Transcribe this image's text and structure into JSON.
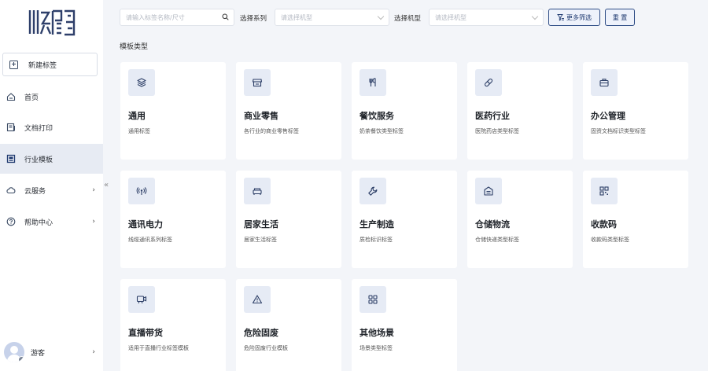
{
  "brand": {
    "logo_text": "斯码"
  },
  "sidebar": {
    "new_label": "新建标签",
    "items": [
      {
        "label": "首页",
        "icon": "home-icon"
      },
      {
        "label": "文档打印",
        "icon": "document-print-icon"
      },
      {
        "label": "行业模板",
        "icon": "template-icon",
        "active": true
      },
      {
        "label": "云服务",
        "icon": "cloud-icon",
        "has_children": true
      },
      {
        "label": "帮助中心",
        "icon": "help-icon",
        "has_children": true
      }
    ],
    "collapse_glyph": "«",
    "user_name": "游客"
  },
  "filters": {
    "search_placeholder": "请输入标签名称/尺寸",
    "series_label": "选择系列",
    "series_placeholder": "请选择机型",
    "model_label": "选择机型",
    "model_placeholder": "请选择机型",
    "more_label": "更多筛选",
    "reset_label": "重 置"
  },
  "section_title": "模板类型",
  "cards": [
    {
      "title": "通用",
      "desc": "通用标签",
      "icon": "layers-icon"
    },
    {
      "title": "商业零售",
      "desc": "各行业的商业零售标签",
      "icon": "store-icon"
    },
    {
      "title": "餐饮服务",
      "desc": "奶茶餐饮类型标签",
      "icon": "utensils-icon"
    },
    {
      "title": "医药行业",
      "desc": "医院药店类型标签",
      "icon": "pill-icon"
    },
    {
      "title": "办公管理",
      "desc": "固资文档标识类型标签",
      "icon": "briefcase-icon"
    },
    {
      "title": "通讯电力",
      "desc": "线缆通讯系列标签",
      "icon": "signal-icon"
    },
    {
      "title": "居家生活",
      "desc": "居家生活标签",
      "icon": "sofa-icon"
    },
    {
      "title": "生产制造",
      "desc": "质检标识标签",
      "icon": "wrench-icon"
    },
    {
      "title": "仓储物流",
      "desc": "仓储快递类型标签",
      "icon": "warehouse-icon"
    },
    {
      "title": "收款码",
      "desc": "收款码类型标签",
      "icon": "qrcode-icon"
    },
    {
      "title": "直播带货",
      "desc": "适用于直播行业标签模板",
      "icon": "live-stream-icon"
    },
    {
      "title": "危险固废",
      "desc": "危险固废行业模板",
      "icon": "warning-icon"
    },
    {
      "title": "其他场景",
      "desc": "场景类型标签",
      "icon": "grid-icon"
    }
  ],
  "colors": {
    "accent": "#2f4d86",
    "icon_bg": "#e6ebf5",
    "page_bg": "#f3f5f9"
  }
}
